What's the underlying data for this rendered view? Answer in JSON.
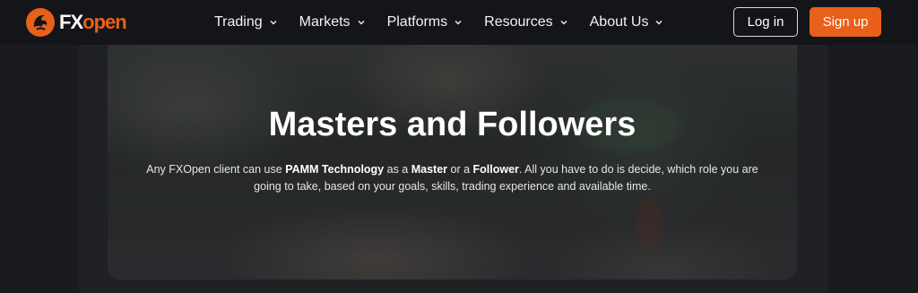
{
  "brand": {
    "name_part1": "FX",
    "name_part2": "open",
    "accent_color": "#e8601a"
  },
  "nav": {
    "items": [
      {
        "label": "Trading",
        "icon": "chevron-down-icon"
      },
      {
        "label": "Markets",
        "icon": "chevron-down-icon"
      },
      {
        "label": "Platforms",
        "icon": "chevron-down-icon"
      },
      {
        "label": "Resources",
        "icon": "chevron-down-icon"
      },
      {
        "label": "About Us",
        "icon": "chevron-down-icon"
      }
    ]
  },
  "auth": {
    "login_label": "Log in",
    "signup_label": "Sign up"
  },
  "hero": {
    "title": "Masters and Followers",
    "desc_1": "Any FXOpen client can use ",
    "desc_bold_1": "PAMM Technology",
    "desc_2": " as a ",
    "desc_bold_2": "Master",
    "desc_3": " or a ",
    "desc_bold_3": "Follower",
    "desc_4": ". All you have to do is decide, which role you are going to take, based on your goals, skills, trading experience and available time."
  }
}
